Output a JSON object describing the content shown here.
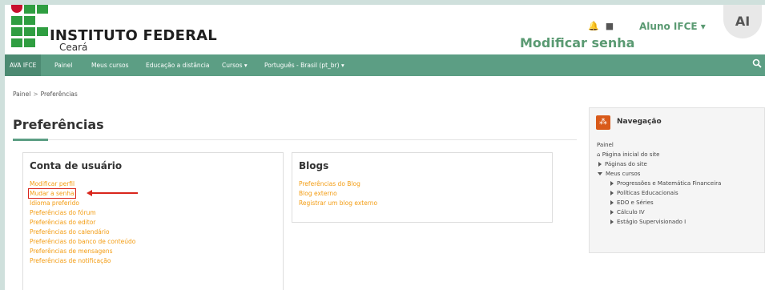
{
  "header": {
    "brand_title": "INSTITUTO FEDERAL",
    "brand_subtitle": "Ceará",
    "page_heading": "Modificar senha",
    "user_name": "Aluno IFCE",
    "user_caret": "▾",
    "avatar_initials": "AI",
    "icons": [
      "notification-bell-icon",
      "messages-icon"
    ]
  },
  "navbar": {
    "items": [
      {
        "label": "AVA IFCE"
      },
      {
        "label": "Painel"
      },
      {
        "label": "Meus cursos"
      },
      {
        "label": "Educação a distância"
      },
      {
        "label": "Cursos ▾"
      },
      {
        "label": "Português - Brasil (pt_br) ▾"
      }
    ],
    "search_icon": "search-icon",
    "bg_color": "#5c9e84"
  },
  "breadcrumb": {
    "items": [
      "Painel",
      "Preferências"
    ],
    "separator": ">"
  },
  "page_title": "Preferências",
  "user_account": {
    "heading": "Conta de usuário",
    "links": [
      "Modificar perfil",
      "Mudar a senha",
      "Idioma preferido",
      "Preferências do fórum",
      "Preferências do editor",
      "Preferências do calendário",
      "Preferências do banco de conteúdo",
      "Preferências de mensagens",
      "Preferências de notificação"
    ]
  },
  "blogs": {
    "heading": "Blogs",
    "links": [
      "Preferências do Blog",
      "Blog externo",
      "Registrar um blog externo"
    ]
  },
  "navigation_block": {
    "title": "Navegação",
    "root": "Painel",
    "items": [
      "Página inicial do site",
      "Páginas do site",
      "Meus cursos",
      "Progressões e Matemática Financeira",
      "Políticas Educacionais",
      "EDO e Séries",
      "Cálculo IV",
      "Estágio Supervisionado I"
    ]
  },
  "colors": {
    "accent": "#5c9e84",
    "link": "#f39c12",
    "highlight": "#d9261c",
    "brand_red": "#c8102e",
    "brand_green": "#2f9e41"
  }
}
